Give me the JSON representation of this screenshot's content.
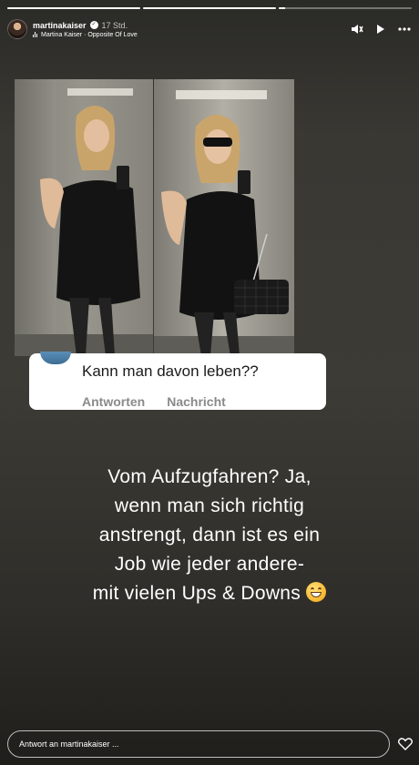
{
  "progress": [
    1,
    1,
    0.05
  ],
  "header": {
    "username": "martinakaiser",
    "verified_mark": "✓",
    "time": "17 Std.",
    "music": "Martina Kaiser · Opposite Of Love",
    "icons": [
      "mute-icon",
      "play-icon",
      "more-icon"
    ]
  },
  "sticker": {
    "question": "Kann man davon leben??",
    "answer_action": "Antworten",
    "message_action": "Nachricht"
  },
  "answer_lines": [
    "Vom Aufzugfahren? Ja,",
    "wenn man sich richtig",
    "anstrengt, dann ist es ein",
    "Job wie jeder andere-",
    "mit vielen Ups & Downs"
  ],
  "reply": {
    "placeholder": "Antwort an martinakaiser ..."
  },
  "colors": {
    "background": "#3a3833",
    "sticker_bg": "#ffffff",
    "action_gray": "#8a8a8a"
  }
}
